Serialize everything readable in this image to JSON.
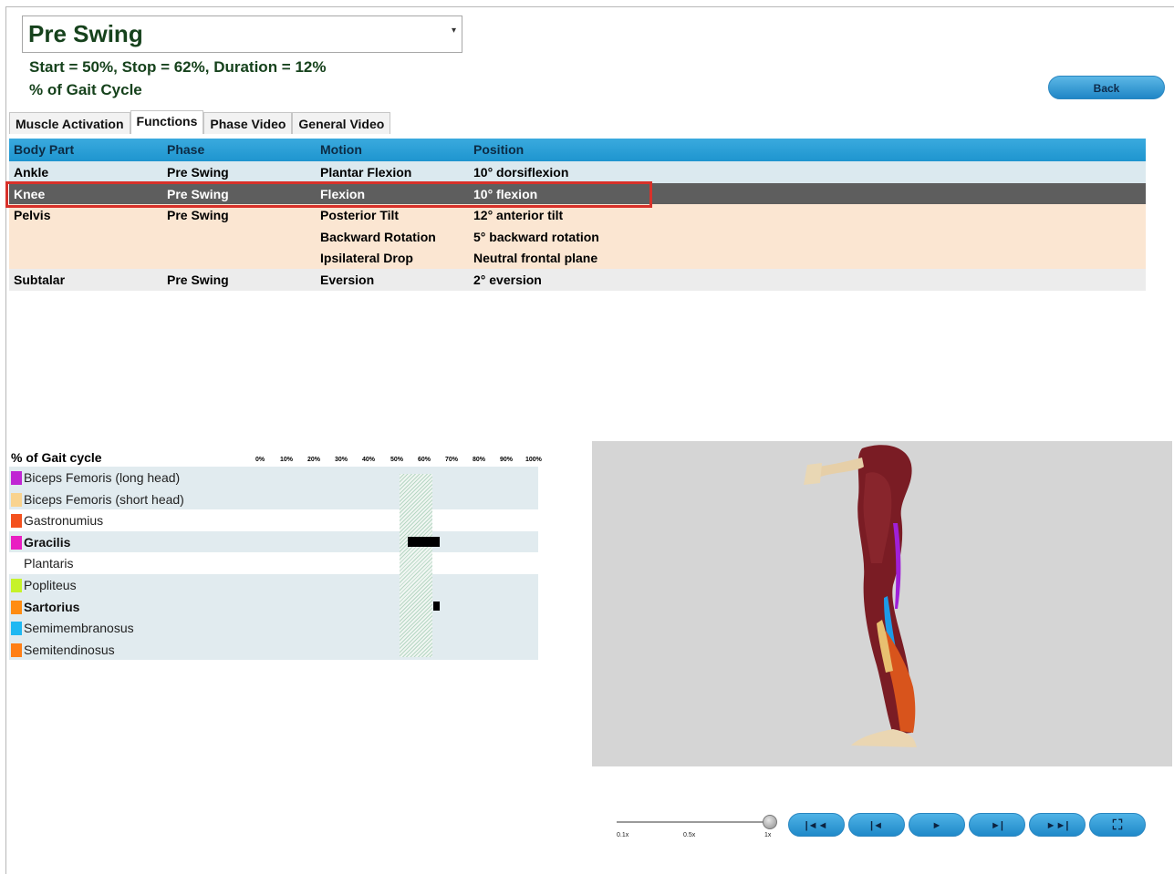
{
  "phase": {
    "selected": "Pre Swing",
    "dropdown_arrow": "▾"
  },
  "stats": {
    "line1": "Start = 50%, Stop = 62%, Duration = 12%",
    "line2": "% of Gait Cycle"
  },
  "back_label": "Back",
  "tabs": [
    "Muscle Activation",
    "Functions",
    "Phase Video",
    "General Video"
  ],
  "active_tab": "Functions",
  "functions": {
    "headers": [
      "Body Part",
      "Phase",
      "Motion",
      "Position"
    ],
    "rows": [
      {
        "part": "Ankle",
        "phase": "Pre Swing",
        "motion": "Plantar Flexion",
        "position": "10° dorsiflexion"
      },
      {
        "part": "Knee",
        "phase": "Pre Swing",
        "motion": "Flexion",
        "position": "10° flexion",
        "selected": true
      },
      {
        "part": "Pelvis",
        "phase": "Pre Swing",
        "motion": "Posterior Tilt",
        "position": "12° anterior tilt"
      },
      {
        "part": "",
        "phase": "",
        "motion": "Backward Rotation",
        "position": "5° backward rotation"
      },
      {
        "part": "",
        "phase": "",
        "motion": "Ipsilateral Drop",
        "position": "Neutral frontal plane"
      },
      {
        "part": "Subtalar",
        "phase": "Pre Swing",
        "motion": "Eversion",
        "position": "2° eversion"
      }
    ]
  },
  "gait_chart": {
    "title": "% of Gait cycle",
    "ticks": [
      "0%",
      "10%",
      "20%",
      "30%",
      "40%",
      "50%",
      "60%",
      "70%",
      "80%",
      "90%",
      "100%"
    ],
    "phase_window_percent": [
      50,
      62
    ],
    "muscles": [
      {
        "name": "Biceps Femoris (long head)",
        "color": "#c026d3",
        "bold": false
      },
      {
        "name": "Biceps Femoris (short head)",
        "color": "#f9d38e",
        "bold": false
      },
      {
        "name": "Gastronumius",
        "color": "#f4511e",
        "bold": false
      },
      {
        "name": "Gracilis",
        "color": "#e91ec2",
        "bold": true,
        "activation_percent": [
          53,
          65
        ]
      },
      {
        "name": "Plantaris",
        "color": "",
        "bold": false
      },
      {
        "name": "Popliteus",
        "color": "#c6f22a",
        "bold": false
      },
      {
        "name": "Sartorius",
        "color": "#ff8c12",
        "bold": true,
        "activation_percent": [
          63,
          65
        ]
      },
      {
        "name": "Semimembranosus",
        "color": "#1fb8f2",
        "bold": false
      },
      {
        "name": "Semitendinosus",
        "color": "#ff7f16",
        "bold": false
      }
    ]
  },
  "speed": {
    "labels": [
      "0.1x",
      "0.5x",
      "1x"
    ],
    "value": "1x"
  },
  "controls": [
    {
      "name": "skip-to-start",
      "glyph": "|◄◄"
    },
    {
      "name": "step-back",
      "glyph": "|◄"
    },
    {
      "name": "play",
      "glyph": "►"
    },
    {
      "name": "step-forward",
      "glyph": "►|"
    },
    {
      "name": "skip-to-end",
      "glyph": "►►|"
    },
    {
      "name": "fullscreen",
      "glyph": "⛶"
    }
  ]
}
